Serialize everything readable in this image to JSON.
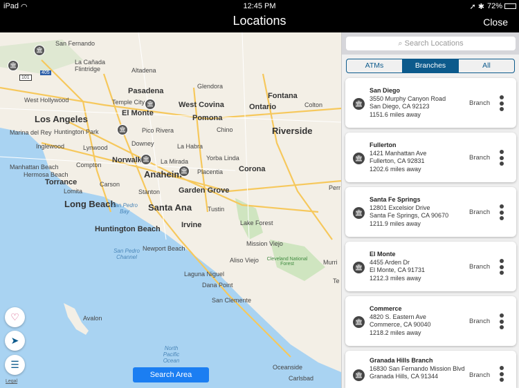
{
  "status": {
    "device": "iPad",
    "time": "12:45 PM",
    "battery": "72%"
  },
  "nav": {
    "title": "Locations",
    "close": "Close"
  },
  "map": {
    "labels": [
      "San Fernando",
      "Altadena",
      "Glendora",
      "Pasadena",
      "West Hollywood",
      "Temple City",
      "El Monte",
      "West Covina",
      "Fontana",
      "Ontario",
      "Colton",
      "Los Angeles",
      "Marina del Rey",
      "Huntington Park",
      "Pico Rivera",
      "Pomona",
      "Chino",
      "Riverside",
      "Inglewood",
      "Lynwood",
      "Downey",
      "La Habra",
      "Norwalk",
      "La Mirada",
      "Yorba Linda",
      "Corona",
      "Manhattan Beach",
      "Hermosa Beach",
      "Compton",
      "Anaheim",
      "Placentia",
      "Torrance",
      "Carson",
      "Lomita",
      "Stanton",
      "Garden Grove",
      "Long Beach",
      "Santa Ana",
      "Tustin",
      "Huntington Beach",
      "Irvine",
      "Lake Forest",
      "Newport Beach",
      "Mission Viejo",
      "Aliso Viejo",
      "Laguna Niguel",
      "Dana Point",
      "San Clemente",
      "Avalon",
      "Oceanside",
      "Carlsbad",
      "Perr",
      "Murri",
      "Te",
      "La Cañada Flintridge",
      "San Pedro Bay",
      "San Pedro Channel",
      "North Pacific Ocean",
      "Cleveland National Forest"
    ],
    "shields": [
      "101",
      "405"
    ],
    "search_area": "Search Area",
    "legal": "Legal"
  },
  "panel": {
    "search_placeholder": "Search Locations",
    "tabs": [
      "ATMs",
      "Branches",
      "All"
    ],
    "selected_tab": "Branches",
    "locations": [
      {
        "name": "San Diego",
        "address": "3550 Murphy Canyon Road",
        "city": "San Diego, CA 92123",
        "distance": "1151.6 miles away",
        "type": "Branch"
      },
      {
        "name": "Fullerton",
        "address": "1421 Manhattan Ave",
        "city": "Fullerton, CA 92831",
        "distance": "1202.6 miles away",
        "type": "Branch"
      },
      {
        "name": "Santa Fe Springs",
        "address": "12801 Excelsior Drive",
        "city": "Santa Fe Springs, CA 90670",
        "distance": "1211.9 miles away",
        "type": "Branch"
      },
      {
        "name": "El Monte",
        "address": "4455 Arden Dr",
        "city": "El Monte, CA 91731",
        "distance": "1212.3 miles away",
        "type": "Branch"
      },
      {
        "name": "Commerce",
        "address": "4820 S. Eastern Ave",
        "city": "Commerce, CA 90040",
        "distance": "1218.2 miles away",
        "type": "Branch"
      },
      {
        "name": "Granada Hills Branch",
        "address": "16830 San Fernando Mission Blvd",
        "city": "Granada Hills, CA 91344",
        "distance": "",
        "type": "Branch"
      }
    ]
  },
  "colors": {
    "accent": "#0c5a8c",
    "search_area": "#1b7ef2",
    "ocean": "#a9d3f2",
    "land": "#f3efe6"
  }
}
